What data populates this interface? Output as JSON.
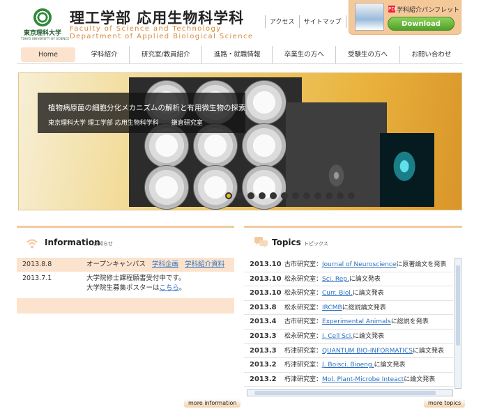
{
  "header": {
    "logo": {
      "jp": "東京理科大学",
      "en": "TOKYO UNIVERSITY OF SCIENCE"
    },
    "title": "理工学部 応用生物科学科",
    "subtitle_line1": "Faculty of Science and Technology",
    "subtitle_line2": "Department of Applied Biological Science",
    "util_links": [
      "アクセス",
      "サイトマップ"
    ],
    "pamphlet": {
      "label": "学科紹介パンフレット",
      "pdf_badge": "PDF",
      "download": "Download"
    }
  },
  "nav": {
    "items": [
      "Home",
      "学科紹介",
      "研究室/教員紹介",
      "進路・就職情報",
      "卒業生の方へ",
      "受験生の方へ",
      "お問い合わせ"
    ]
  },
  "hero": {
    "caption_title": "植物病原菌の細胞分化メカニズムの解析と有用微生物の探索",
    "caption_sub": "東京理科大学 理工学部 応用生物科学科　　鎌倉研究室",
    "slide_count": 12,
    "active_slide": 1
  },
  "info": {
    "title": "Information",
    "title_sub": "お知らせ",
    "rows": [
      {
        "date": "2013.8.8",
        "text": "オープンキャンパス",
        "link1": "学科企画",
        "link2": "学科紹介資料"
      },
      {
        "date": "2013.7.1",
        "text": "大学院修士課程願書受付中です。",
        "text2_pre": "大学院生募集ポスターは",
        "text2_link": "こちら",
        "text2_post": "。"
      }
    ],
    "more": "more information"
  },
  "topics": {
    "title": "Topics",
    "title_sub": "トピックス",
    "rows": [
      {
        "date": "2013.10",
        "lab": "古市研究室：",
        "link": "Journal of Neuroscience",
        "suffix": "に原著論文を発表"
      },
      {
        "date": "2013.10",
        "lab": "松永研究室：",
        "link": "Sci. Rep.",
        "suffix": "に論文発表"
      },
      {
        "date": "2013.10",
        "lab": "松永研究室：",
        "link": "Curr. Biol.",
        "suffix": "に論文発表"
      },
      {
        "date": "2013.8",
        "lab": "松永研究室：",
        "link": "IRCMB",
        "suffix": "に総説論文発表"
      },
      {
        "date": "2013.4",
        "lab": "古市研究室：",
        "link": "Experimental Animals",
        "suffix": "に総説を発表"
      },
      {
        "date": "2013.3",
        "lab": "松永研究室：",
        "link": "J. Cell Sci.",
        "suffix": "に論文発表"
      },
      {
        "date": "2013.3",
        "lab": "朽津研究室：",
        "link": "QUANTUM BIO-INFORMATICS",
        "suffix": "に論文発表"
      },
      {
        "date": "2013.2",
        "lab": "朽津研究室：",
        "link": "J. Boisci. Bioeng.",
        "suffix": "に論文発表"
      },
      {
        "date": "2013.2",
        "lab": "朽津研究室：",
        "link": "Mol. Plant-Microbe Inteact",
        "suffix": "に論文発表"
      }
    ],
    "more": "more topics"
  },
  "colors": {
    "accent": "#f3c9a0",
    "link": "#2a6fc0",
    "download": "#5fb032"
  }
}
